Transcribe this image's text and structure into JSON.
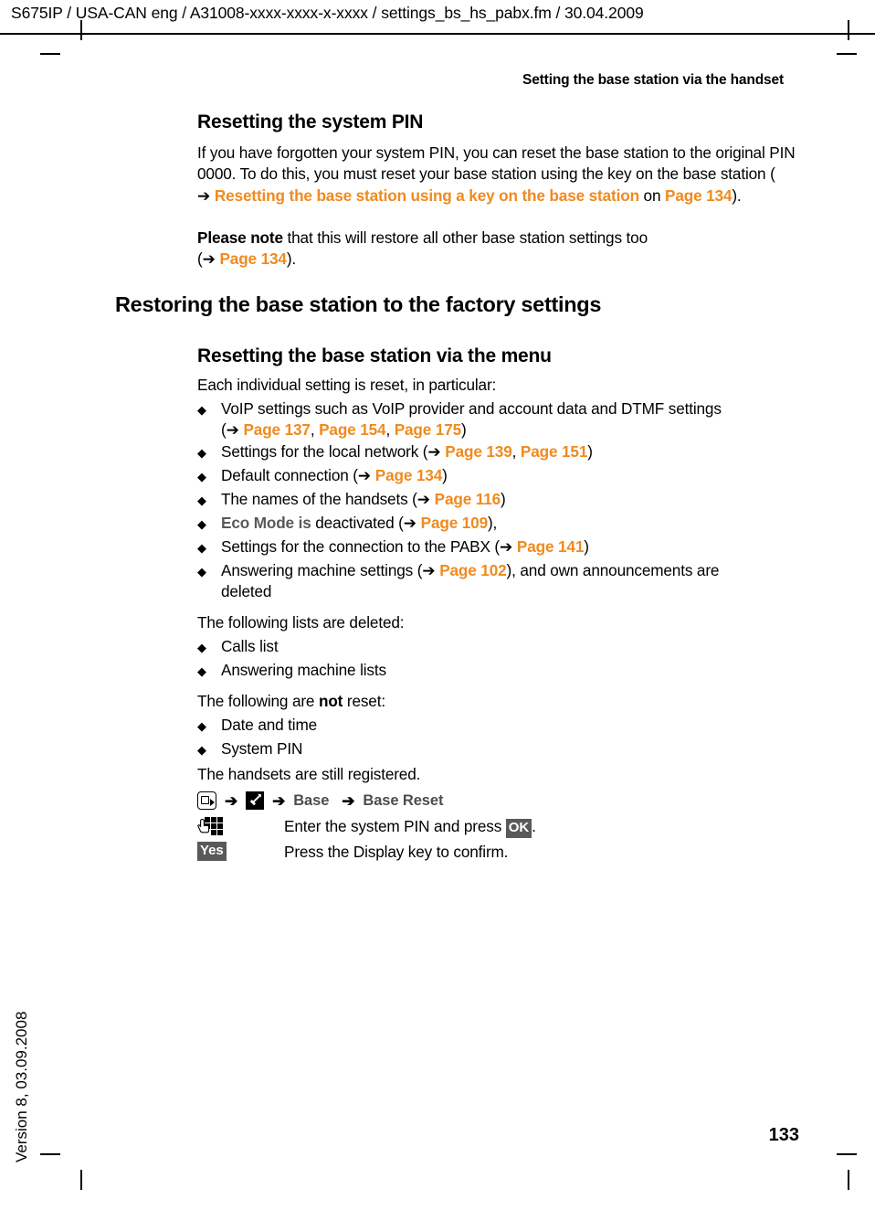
{
  "header": {
    "doc_id": "S675IP  / USA-CAN eng / A31008-xxxx-xxxx-x-xxxx / settings_bs_hs_pabx.fm / 30.04.2009",
    "running_head": "Setting the base station via the handset"
  },
  "footer": {
    "side_stamp": "Version 8, 03.09.2008",
    "page_number": "133"
  },
  "colors": {
    "reference_orange": "#f08a1e",
    "ui_label_gray": "#595959",
    "menu_item_gray": "#4d4d4d",
    "text_black": "#000000"
  },
  "sections": {
    "pin_reset": {
      "heading": "Resetting the system PIN",
      "para_1_pre": "If you have forgotten your system PIN, you can reset the base station to the original PIN 0000. To do this, you must reset your base station using the key on the base station ( ",
      "para_1_arrow": "➔",
      "para_1_ref_title": "Resetting the base station using a key on the base station",
      "para_1_mid": " on ",
      "para_1_ref_page": "Page 134",
      "para_1_post": ").",
      "para_2_bold": "Please note",
      "para_2_text": " that this will restore all other base station settings too",
      "para_2_line2_open": "(",
      "para_2_line2_arrow": "➔",
      "para_2_line2_ref": "Page 134",
      "para_2_line2_close": ")."
    },
    "factory_reset": {
      "heading": "Restoring the base station to the factory settings",
      "subheading": "Resetting the base station via the menu",
      "intro": "Each individual setting is reset, in particular:",
      "reset_items": [
        {
          "line1_text": "VoIP settings such as VoIP provider and account data and DTMF settings",
          "line2_open": "(",
          "line2_arrow": "➔",
          "line2_refs": [
            "Page 137",
            "Page 154",
            "Page 175"
          ],
          "line2_close": ")"
        },
        {
          "line1_text": "Settings for the local network (",
          "line1_arrow": "➔",
          "line1_refs": [
            "Page 139",
            "Page 151"
          ],
          "line1_close": ")"
        },
        {
          "line1_text": "Default connection (",
          "line1_arrow": "➔",
          "line1_refs": [
            "Page 134"
          ],
          "line1_close": ")"
        },
        {
          "line1_text": "The names of the handsets (",
          "line1_arrow": "➔",
          "line1_refs": [
            "Page 116"
          ],
          "line1_close": ")"
        },
        {
          "ui_label": "Eco Mode is",
          "line1_text": " deactivated (",
          "line1_arrow": "➔",
          "line1_refs": [
            "Page 109"
          ],
          "line1_close": "),"
        },
        {
          "line1_text": "Settings for the connection to the PABX (",
          "line1_arrow": "➔",
          "line1_refs": [
            "Page 141"
          ],
          "line1_close": ")"
        },
        {
          "line1_text": "Answering machine settings (",
          "line1_arrow": "➔",
          "line1_refs": [
            "Page 102"
          ],
          "line1_close": "), and own announcements are",
          "line2_text": "deleted"
        }
      ],
      "deleted_intro": "The following lists are deleted:",
      "deleted_items": [
        "Calls list",
        "Answering machine lists"
      ],
      "not_reset_intro_pre": "The following are ",
      "not_reset_intro_bold": "not",
      "not_reset_intro_post": " reset:",
      "not_reset_items": [
        "Date and time",
        "System PIN"
      ],
      "closing": "The handsets are still registered."
    },
    "steps": {
      "menu_path": {
        "icon_1": "display-key-icon",
        "arrow": "➔",
        "icon_2": "settings-wrench-icon",
        "item_1": "Base",
        "item_2": "Base Reset"
      },
      "step_pin": {
        "icon": "keypad-icon",
        "text_pre": "Enter the system PIN and press ",
        "key_chip": "OK",
        "text_post": "."
      },
      "step_confirm": {
        "key_chip": "Yes",
        "text": "Press the Display key to confirm."
      }
    }
  }
}
